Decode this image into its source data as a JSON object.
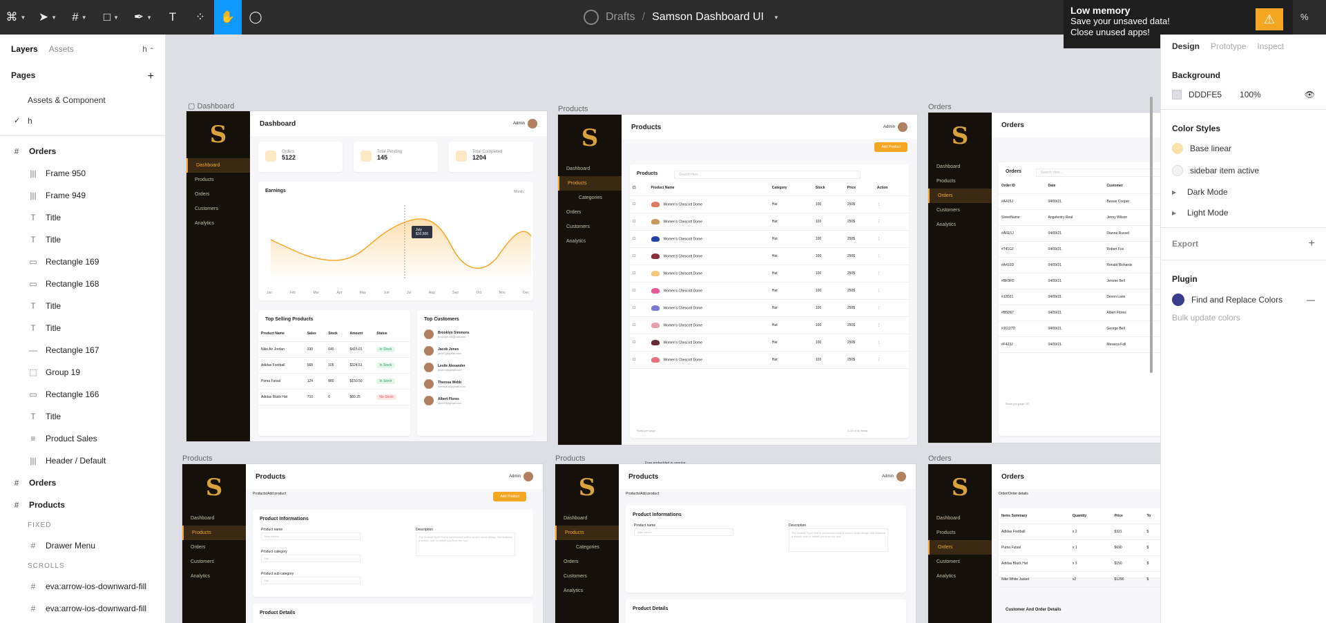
{
  "toolbar": {
    "breadcrumb_drafts": "Drafts",
    "breadcrumb_sep": "/",
    "file_name": "Samson Dashboard UI",
    "zoom": "%"
  },
  "low_memory": {
    "title": "Low memory",
    "line1": "Save your unsaved data!",
    "line2": "Close unused apps!"
  },
  "left": {
    "tab_layers": "Layers",
    "tab_assets": "Assets",
    "page_select": "h",
    "pages_label": "Pages",
    "pages": [
      "Assets & Component",
      "h"
    ],
    "layers": [
      {
        "icon": "#",
        "label": "Orders",
        "bold": true,
        "sub": false
      },
      {
        "icon": "|||",
        "label": "Frame 950",
        "sub": true
      },
      {
        "icon": "|||",
        "label": "Frame 949",
        "sub": true
      },
      {
        "icon": "T",
        "label": "Title",
        "sub": true
      },
      {
        "icon": "T",
        "label": "Title",
        "sub": true
      },
      {
        "icon": "▭",
        "label": "Rectangle 169",
        "sub": true
      },
      {
        "icon": "▭",
        "label": "Rectangle 168",
        "sub": true
      },
      {
        "icon": "T",
        "label": "Title",
        "sub": true
      },
      {
        "icon": "T",
        "label": "Title",
        "sub": true
      },
      {
        "icon": "—",
        "label": "Rectangle 167",
        "sub": true
      },
      {
        "icon": "⬚",
        "label": "Group 19",
        "sub": true
      },
      {
        "icon": "▭",
        "label": "Rectangle 166",
        "sub": true
      },
      {
        "icon": "T",
        "label": "Title",
        "sub": true
      },
      {
        "icon": "≡",
        "label": "Product Sales",
        "sub": true
      },
      {
        "icon": "|||",
        "label": "Header / Default",
        "sub": true
      },
      {
        "icon": "#",
        "label": "Orders",
        "bold": true,
        "sub": false
      },
      {
        "icon": "#",
        "label": "Products",
        "bold": true,
        "sub": false
      }
    ],
    "fixed_label": "FIXED",
    "fixed_item": "Drawer Menu",
    "scrolls_label": "SCROLLS",
    "scroll_items": [
      "eva:arrow-ios-downward-fill",
      "eva:arrow-ios-downward-fill"
    ]
  },
  "canvas": {
    "labels": {
      "dashboard": "Dashboard",
      "products": "Products",
      "orders": "Orders",
      "products2": "Products",
      "products3": "Products",
      "orders2": "Orders"
    },
    "menu": {
      "dashboard": "Dashboard",
      "products": "Products",
      "categories": "Categories",
      "orders": "Orders",
      "customers": "Customers",
      "analytics": "Analytics"
    },
    "dash": {
      "title": "Dashboard",
      "admin": "Admin",
      "stats": [
        {
          "label": "Orders",
          "value": "5122"
        },
        {
          "label": "Total Pending",
          "value": "145"
        },
        {
          "label": "Total Completed",
          "value": "1204"
        }
      ],
      "earnings": "Earnings",
      "period": "Month",
      "tooltip_month": "July",
      "tooltip_value": "$10,500",
      "months": [
        "Jan",
        "Feb",
        "Mar",
        "Apr",
        "May",
        "Jun",
        "Jul",
        "Aug",
        "Sep",
        "Oct",
        "Nov",
        "Dec"
      ],
      "top_selling": "Top Selling Products",
      "ts_head": [
        "Product Name",
        "Sales",
        "Stock",
        "Amount",
        "Status"
      ],
      "ts_rows": [
        [
          "Nike Air Jordan",
          "330",
          "645",
          "$415.01",
          "In Stock"
        ],
        [
          "Adidas Football",
          "568",
          "105",
          "$324.51",
          "In Stock"
        ],
        [
          "Puma Futsal",
          "124",
          "880",
          "$150.50",
          "In Stock"
        ],
        [
          "Adidas Black Hat",
          "710",
          "0",
          "$60.25",
          "No Stock"
        ]
      ],
      "top_customers": "Top Customers",
      "customers": [
        {
          "name": "Brooklyn Simmons",
          "email": "brooklyn.s@gmail.com"
        },
        {
          "name": "Jacob Jones",
          "email": "jacob.j@gmail.com"
        },
        {
          "name": "Leslie Alexander",
          "email": "leslie.a@gmail.com"
        },
        {
          "name": "Theresa Webb",
          "email": "theresa.w@gmail.com"
        },
        {
          "name": "Albert Flores",
          "email": "albert.f@gmail.com"
        }
      ]
    },
    "prod": {
      "title": "Products",
      "admin": "Admin",
      "add": "Add Product",
      "card": "Products",
      "search": "Search Here...",
      "head": [
        "Product Name",
        "Category",
        "Stock",
        "Price",
        "Action"
      ],
      "rows": [
        [
          "Women's Chescott Dome",
          "Hat",
          "100",
          "250$"
        ],
        [
          "Women's Chescott Dome",
          "Hat",
          "100",
          "250$"
        ],
        [
          "Women's Chescott Dome",
          "Hat",
          "100",
          "250$"
        ],
        [
          "Women's Chescott Dome",
          "Hat",
          "100",
          "250$"
        ],
        [
          "Women's Chescott Dome",
          "Hat",
          "100",
          "250$"
        ],
        [
          "Women's Chescott Dome",
          "Hat",
          "100",
          "250$"
        ],
        [
          "Women's Chescott Dome",
          "Hat",
          "100",
          "250$"
        ],
        [
          "Women's Chescott Dome",
          "Hat",
          "100",
          "250$"
        ],
        [
          "Women's Chescott Dome",
          "Hat",
          "100",
          "250$"
        ],
        [
          "Women's Chescott Dome",
          "Hat",
          "100",
          "250$"
        ]
      ],
      "hat_colors": [
        "#e07a5f",
        "#c79a5a",
        "#2244aa",
        "#8a2a3a",
        "#f3c97a",
        "#e85a9a",
        "#7a7ad0",
        "#e8a0b0",
        "#6a2a3a",
        "#e8707a"
      ],
      "rows_per_page": "Rows per page:",
      "pager": "1-10 of 50 items"
    },
    "orders": {
      "title": "Orders",
      "card": "Orders",
      "search": "Search Here...",
      "head": [
        "Order ID",
        "Date",
        "Customer"
      ],
      "rows": [
        [
          "#A415J",
          "04/09/21",
          "Bessie Cooper"
        ],
        [
          "StreetName",
          "Angelentry Real",
          "Jenny Wilson"
        ],
        [
          "#AFE1J",
          "04/09/21",
          "Dianne Russel"
        ],
        [
          "#741GJ",
          "04/09/21",
          "Robert Fox"
        ],
        [
          "#A410D",
          "04/09/21",
          "Ronald Richards"
        ],
        [
          "#BF9FD",
          "04/09/21",
          "Jerome Bell"
        ],
        [
          "#J2D21",
          "04/09/21",
          "Devon Lane"
        ],
        [
          "#B5D67",
          "04/09/21",
          "Albert Flores"
        ],
        [
          "#J6127D",
          "04/09/21",
          "George Bell"
        ],
        [
          "#F423J",
          "04/09/21",
          "Messica Fall"
        ]
      ],
      "rows_per_page": "Rows per page: 10"
    },
    "add": {
      "title": "Products",
      "crumb": "Products/Add product",
      "add": "Add Product",
      "info": "Product Informations",
      "name": "Product name",
      "name_ph": "Nike cables",
      "desc": "Description",
      "desc_ph": "The football Sport Hat is constructed with a woven straw design that features a stretch over to shield you from the sun.",
      "cat": "Product category",
      "cat_ph": "Hat",
      "subcat": "Product sub category",
      "details": "Product Details",
      "free": "Free embedded in angular"
    },
    "odetail": {
      "title": "Orders",
      "crumb": "Order/Order details",
      "head": [
        "Items Summary",
        "Quantity",
        "Price",
        "To"
      ],
      "rows": [
        [
          "Adidas Football",
          "x 2",
          "$321",
          "$"
        ],
        [
          "Puma Futsal",
          "x 1",
          "$690",
          "$"
        ],
        [
          "Adidas Black Hat",
          "x 3",
          "$150",
          "$"
        ],
        [
          "Nike White Jacket",
          "x2",
          "$1290",
          "$"
        ]
      ],
      "cust": "Customer And Order Details"
    }
  },
  "right": {
    "tabs": [
      "Design",
      "Prototype",
      "Inspect"
    ],
    "background": "Background",
    "bg_hex": "DDDFE5",
    "bg_opacity": "100%",
    "color_styles": "Color Styles",
    "styles": [
      {
        "name": "Base linear",
        "color": "#fde2a8"
      },
      {
        "name": "sidebar item active",
        "color": "#f2f2f2"
      },
      {
        "name": "Dark Mode"
      },
      {
        "name": "Light Mode"
      }
    ],
    "export": "Export",
    "plugin": "Plugin",
    "plugin_name": "Find and Replace Colors",
    "plugin_sub": "Bulk update colors"
  }
}
